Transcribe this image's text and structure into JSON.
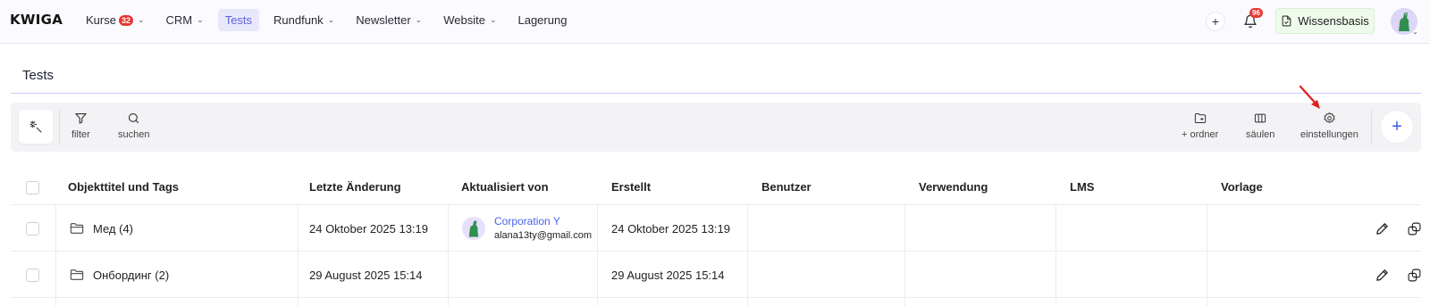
{
  "app": {
    "logo": "KWIGA"
  },
  "nav": {
    "items": [
      {
        "label": "Kurse",
        "badge": "32",
        "dropdown": true,
        "active": false
      },
      {
        "label": "CRM",
        "dropdown": true,
        "active": false
      },
      {
        "label": "Tests",
        "dropdown": false,
        "active": true
      },
      {
        "label": "Rundfunk",
        "dropdown": true,
        "active": false
      },
      {
        "label": "Newsletter",
        "dropdown": true,
        "active": false
      },
      {
        "label": "Website",
        "dropdown": true,
        "active": false
      },
      {
        "label": "Lagerung",
        "dropdown": false,
        "active": false
      }
    ]
  },
  "header_right": {
    "add_icon": "plus-icon",
    "notifications_count": "96",
    "knowledge_base_label": "Wissensbasis"
  },
  "page": {
    "title": "Tests"
  },
  "toolbar": {
    "filter_label": "filter",
    "search_label": "suchen",
    "add_folder_label": "+ ordner",
    "columns_label": "säulen",
    "settings_label": "einstellungen"
  },
  "table": {
    "columns": [
      "Objekttitel und Tags",
      "Letzte Änderung",
      "Aktualisiert von",
      "Erstellt",
      "Benutzer",
      "Verwendung",
      "LMS",
      "Vorlage"
    ],
    "rows": [
      {
        "title": "Мед (4)",
        "last_modified": "24 Oktober 2025 13:19",
        "updated_by_name": "Corporation Y",
        "updated_by_email": "alana13ty@gmail.com",
        "created": "24 Oktober 2025 13:19"
      },
      {
        "title": "Онбординг (2)",
        "last_modified": "29 August 2025 15:14",
        "updated_by_name": "",
        "updated_by_email": "",
        "created": "29 August 2025 15:14"
      }
    ]
  },
  "colors": {
    "accent": "#5b63d8",
    "link": "#4a63e8",
    "badge": "#e53935",
    "annotation_arrow": "#e0201b"
  }
}
